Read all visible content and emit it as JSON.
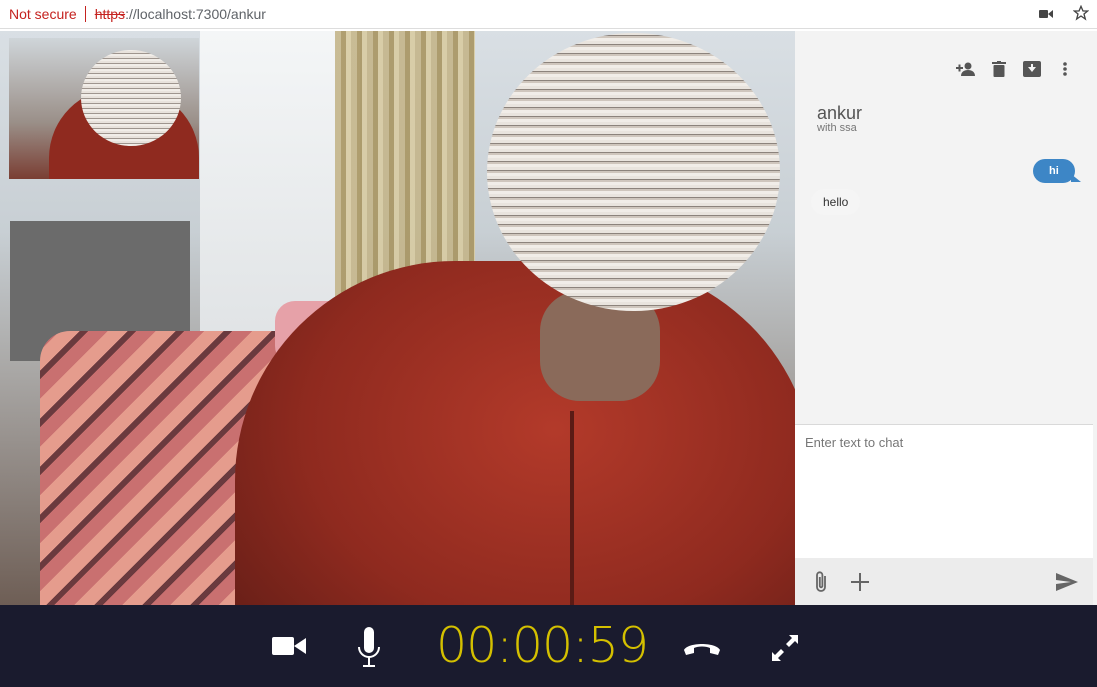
{
  "browser": {
    "security": "Not secure",
    "url_protocol": "https",
    "url_rest": "://localhost:7300/ankur",
    "icons": [
      "camera-icon",
      "star-icon"
    ]
  },
  "video": {
    "remote_feed": "remote-video",
    "local_feed": "local-video-pip"
  },
  "chat": {
    "header_icons": [
      "add-person-icon",
      "delete-icon",
      "archive-icon",
      "more-vert-icon"
    ],
    "name": "ankur",
    "subtitle": "with ssa",
    "messages": [
      {
        "from": "me",
        "text": "hi"
      },
      {
        "from": "them",
        "text": "hello"
      }
    ],
    "input_placeholder": "Enter text to chat",
    "footer_icons": [
      "attach-icon",
      "add-icon",
      "send-icon"
    ]
  },
  "controls": {
    "timer": "00:00:59",
    "accent": "#d4c000",
    "buttons": [
      "video-camera-icon",
      "microphone-icon",
      "hang-up-icon",
      "fullscreen-icon"
    ]
  }
}
